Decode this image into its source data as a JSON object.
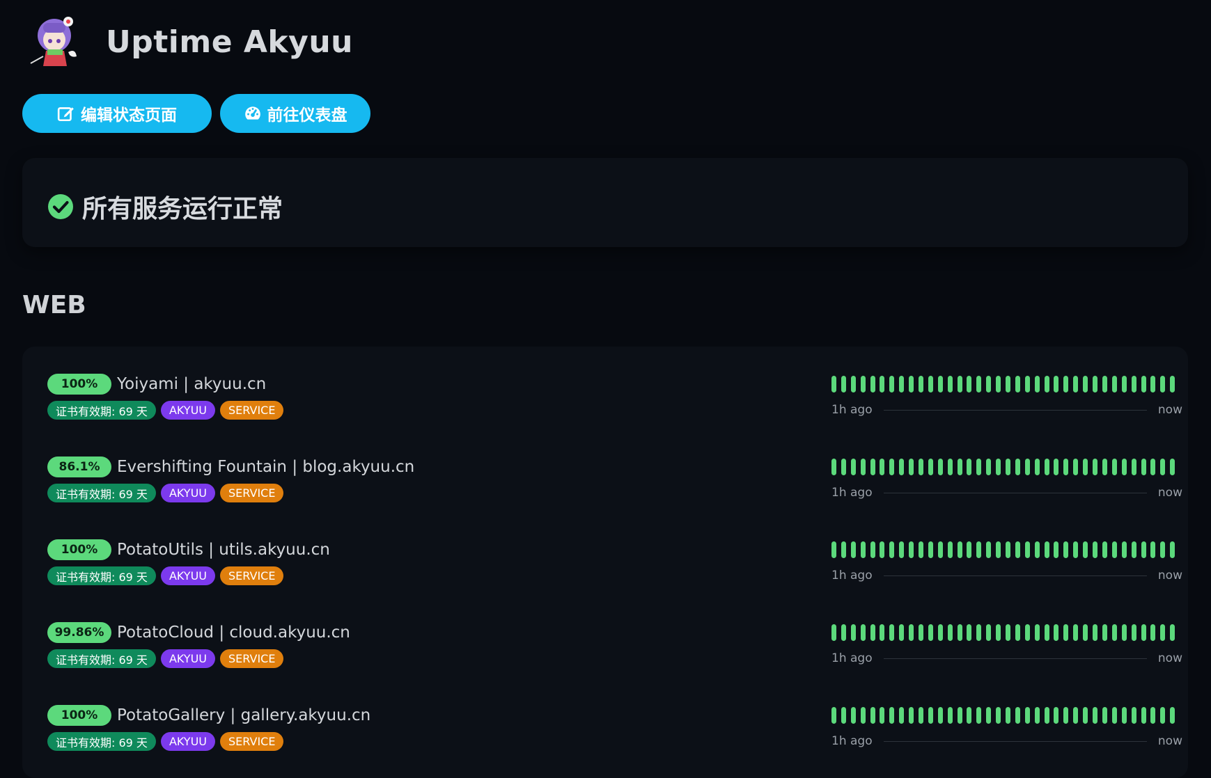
{
  "app": {
    "title": "Uptime Akyuu"
  },
  "buttons": {
    "edit": "编辑状态页面",
    "dashboard": "前往仪表盘"
  },
  "status": {
    "text": "所有服务运行正常"
  },
  "section": {
    "title": "WEB"
  },
  "timeline": {
    "start": "1h ago",
    "end": "now"
  },
  "monitors": [
    {
      "uptime": "100%",
      "name": "Yoiyami | akyuu.cn",
      "cert": "证书有效期: 69 天",
      "tag1": "AKYUU",
      "tag2": "SERVICE"
    },
    {
      "uptime": "86.1%",
      "name": "Evershifting Fountain | blog.akyuu.cn",
      "cert": "证书有效期: 69 天",
      "tag1": "AKYUU",
      "tag2": "SERVICE"
    },
    {
      "uptime": "100%",
      "name": "PotatoUtils | utils.akyuu.cn",
      "cert": "证书有效期: 69 天",
      "tag1": "AKYUU",
      "tag2": "SERVICE"
    },
    {
      "uptime": "99.86%",
      "name": "PotatoCloud | cloud.akyuu.cn",
      "cert": "证书有效期: 69 天",
      "tag1": "AKYUU",
      "tag2": "SERVICE"
    },
    {
      "uptime": "100%",
      "name": "PotatoGallery | gallery.akyuu.cn",
      "cert": "证书有效期: 69 天",
      "tag1": "AKYUU",
      "tag2": "SERVICE"
    }
  ],
  "colors": {
    "accent": "#16b9f0",
    "up": "#5cd97c",
    "cert": "#0f8a5b",
    "akyuu": "#7c3aed",
    "service": "#e07f0d"
  },
  "beats_per_monitor": 36
}
